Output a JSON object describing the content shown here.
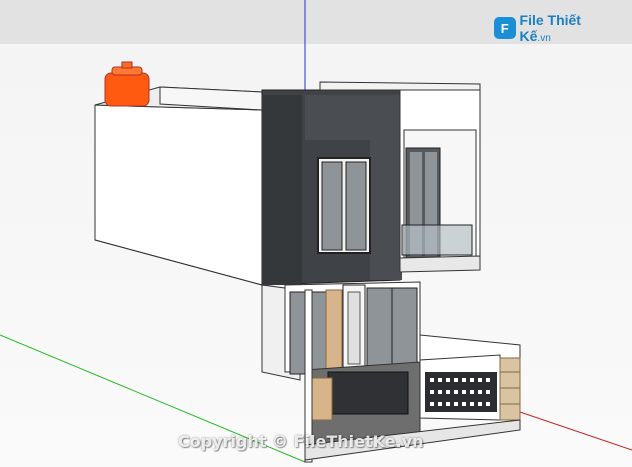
{
  "viewer": {
    "logo": {
      "icon": "file-logo-icon",
      "mark": "F",
      "name": "File Thiết Kế",
      "domain": ".vn"
    },
    "copyright": "Copyright © FileThietKe.vn"
  },
  "colors": {
    "sky": "#e2e2e2",
    "ground": "#f6f6f6",
    "blue_axis": "#2233cc",
    "green_axis": "#22bb22",
    "red_axis": "#cc2222",
    "facade_dark": "#3f4246",
    "wall_white": "#ffffff",
    "wall_shade": "#cfcfcf",
    "tank": "#ff5a10",
    "wood": "#d8b48a"
  }
}
